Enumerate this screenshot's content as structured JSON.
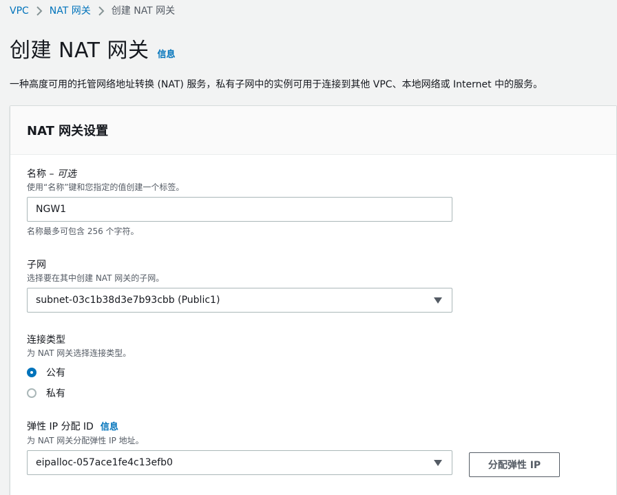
{
  "breadcrumb": {
    "items": [
      "VPC",
      "NAT 网关",
      "创建 NAT 网关"
    ]
  },
  "header": {
    "title": "创建 NAT 网关",
    "info_link": "信息",
    "description": "一种高度可用的托管网络地址转换 (NAT) 服务，私有子网中的实例可用于连接到其他 VPC、本地网络或 Internet 中的服务。"
  },
  "panel": {
    "title": "NAT 网关设置",
    "name_field": {
      "label": "名称 – ",
      "optional": "可选",
      "hint": "使用“名称”键和您指定的值创建一个标签。",
      "value": "NGW1",
      "constraint": "名称最多可包含 256 个字符。"
    },
    "subnet_field": {
      "label": "子网",
      "hint": "选择要在其中创建 NAT 网关的子网。",
      "selected": "subnet-03c1b38d3e7b93cbb (Public1)"
    },
    "connectivity_field": {
      "label": "连接类型",
      "hint": "为 NAT 网关选择连接类型。",
      "options": [
        {
          "label": "公有",
          "checked": true
        },
        {
          "label": "私有",
          "checked": false
        }
      ]
    },
    "eip_field": {
      "label": "弹性 IP 分配 ID",
      "info_link": "信息",
      "hint": "为 NAT 网关分配弹性 IP 地址。",
      "selected": "eipalloc-057ace1fe4c13efb0",
      "button_label": "分配弹性 IP"
    }
  },
  "colors": {
    "link": "#0073bb",
    "radio_selected": "#0073bb",
    "page_bg": "#f2f3f3"
  }
}
